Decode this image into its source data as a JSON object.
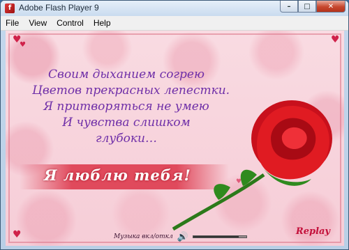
{
  "window": {
    "title": "Adobe Flash Player 9"
  },
  "menu": {
    "items": [
      "File",
      "View",
      "Control",
      "Help"
    ]
  },
  "poem": {
    "lines": [
      "Своим дыханием согрею",
      "Цветов прекрасных лепестки.",
      "Я притворяться не умею",
      "И чувства слишком",
      "глубоки…"
    ]
  },
  "love_text": "Я люблю тебя!",
  "controls": {
    "music_label": "Музыка вкл/откл",
    "volume_level": 0.85
  },
  "replay_label": "Replay",
  "colors": {
    "poem": "#6f2fa8",
    "accent": "#c3103a",
    "background": "#f8d6de"
  },
  "icons": [
    "flash-app-icon",
    "minimize-icon",
    "maximize-icon",
    "close-icon",
    "heart-icon",
    "speaker-icon"
  ]
}
